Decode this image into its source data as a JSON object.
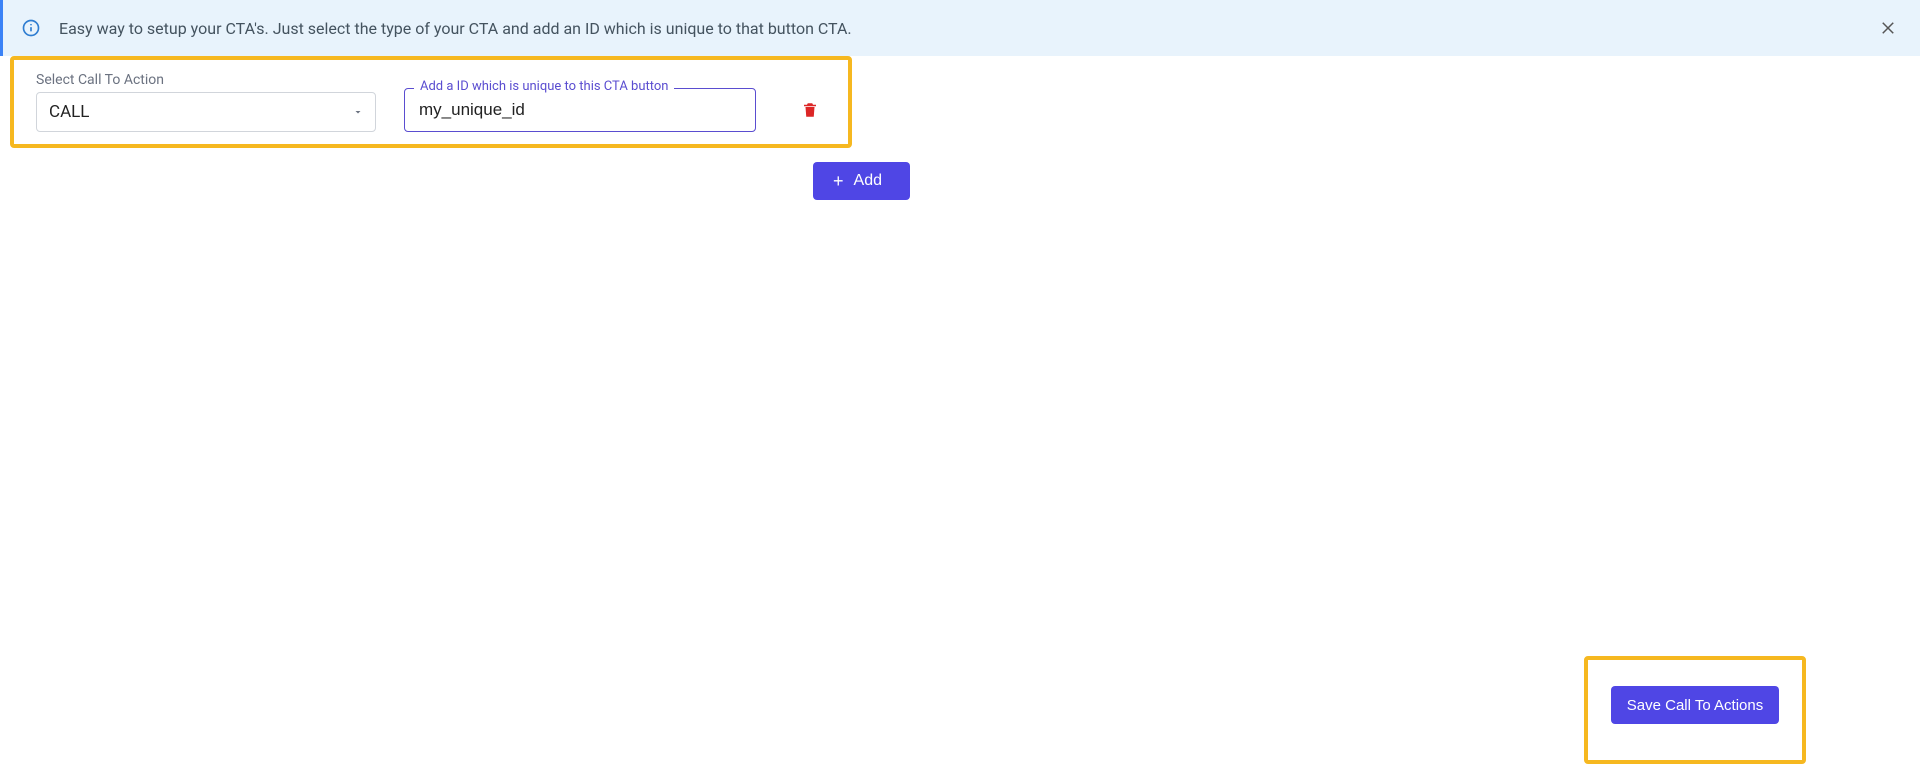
{
  "banner": {
    "message": "Easy way to setup your CTA's. Just select the type of your CTA and add an ID which is unique to that button CTA."
  },
  "cta_row": {
    "select_label": "Select Call To Action",
    "select_value": "CALL",
    "id_label": "Add a ID which is unique to this CTA button",
    "id_value": "my_unique_id"
  },
  "buttons": {
    "add": "Add",
    "save": "Save Call To Actions"
  }
}
